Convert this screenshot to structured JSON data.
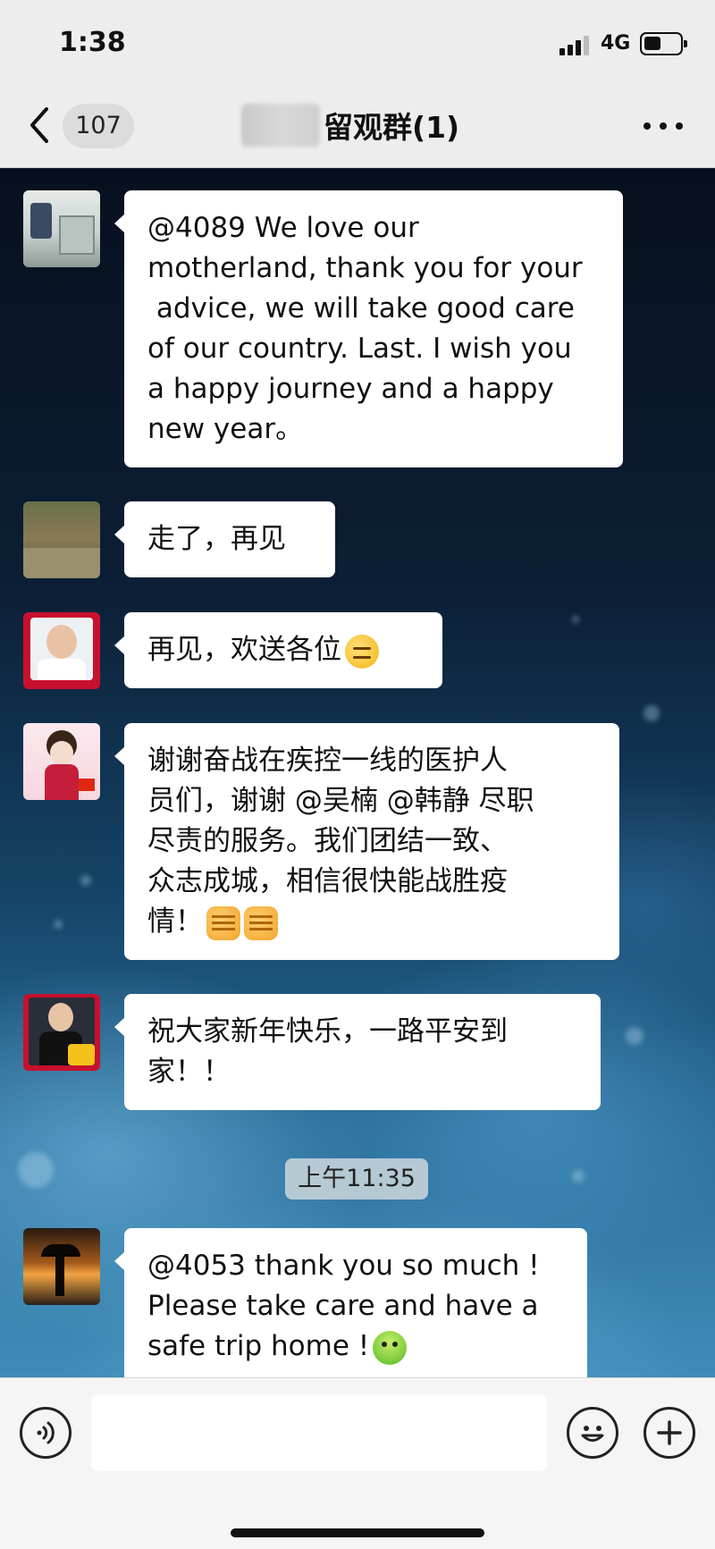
{
  "status_bar": {
    "time": "1:38",
    "network": "4G"
  },
  "nav": {
    "unread_count": "107",
    "title": "留观群(1)"
  },
  "messages": [
    {
      "text": "@4089 We love our\nmotherland, thank you for your\n advice, we will take good care\nof our country. Last. I wish you\na happy journey and a happy\nnew year。",
      "emoji": ""
    },
    {
      "text": "走了，再见",
      "emoji": ""
    },
    {
      "text": "再见，欢送各位",
      "emoji": "thinking-face"
    },
    {
      "text": "谢谢奋战在疾控一线的医护人\n员们，谢谢 @吴楠 @韩静 尽职\n尽责的服务。我们团结一致、\n众志成城，相信很快能战胜疫\n情！",
      "emoji": "fist x2"
    },
    {
      "text": "祝大家新年快乐，一路平安到\n家！！",
      "emoji": ""
    },
    {
      "text": "@4053 thank you so much !\nPlease take care and have a\nsafe trip home !",
      "emoji": "frog"
    }
  ],
  "timestamp": "上午11:35",
  "input": {
    "value": ""
  },
  "icons": [
    "back-chevron",
    "more-dots",
    "voice",
    "emoji",
    "plus"
  ]
}
